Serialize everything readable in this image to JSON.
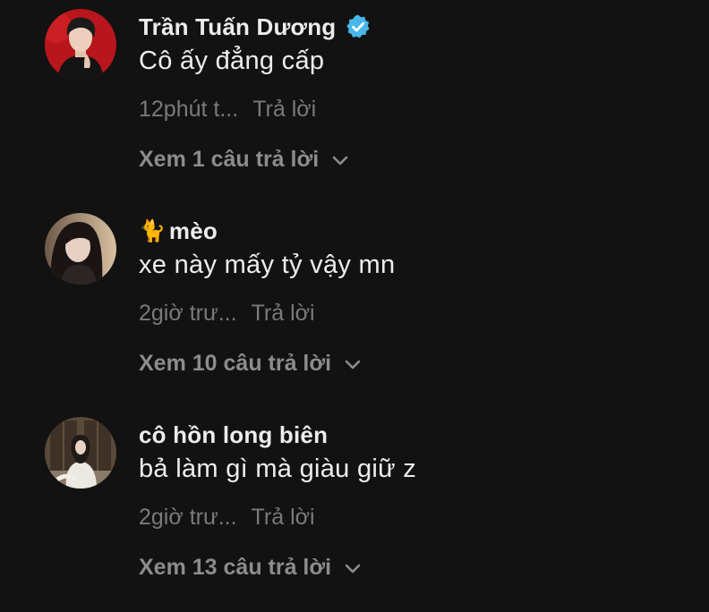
{
  "colors": {
    "background": "#121212",
    "verified_badge": "#48b6e8",
    "muted_text": "#7a7a7a"
  },
  "comments": [
    {
      "avatar_icon": "avatar-man-red-background",
      "username": "Trần Tuấn Dương",
      "verified": true,
      "text": "Cô ấy đẳng cấp",
      "time": "12phút t...",
      "reply_label": "Trả lời",
      "view_replies_label": "Xem 1 câu trả lời"
    },
    {
      "avatar_icon": "avatar-girl-dark-hair",
      "name_emoji": "🐈",
      "username": "mèo",
      "verified": false,
      "text": "xe này mấy tỷ vậy mn",
      "time": "2giờ trư...",
      "reply_label": "Trả lời",
      "view_replies_label": "Xem 10 câu trả lời"
    },
    {
      "avatar_icon": "avatar-girl-white-dress",
      "username": "cô hồn long biên",
      "verified": false,
      "text": "bả làm gì mà giàu giữ z",
      "time": "2giờ trư...",
      "reply_label": "Trả lời",
      "view_replies_label": "Xem 13 câu trả lời"
    }
  ]
}
